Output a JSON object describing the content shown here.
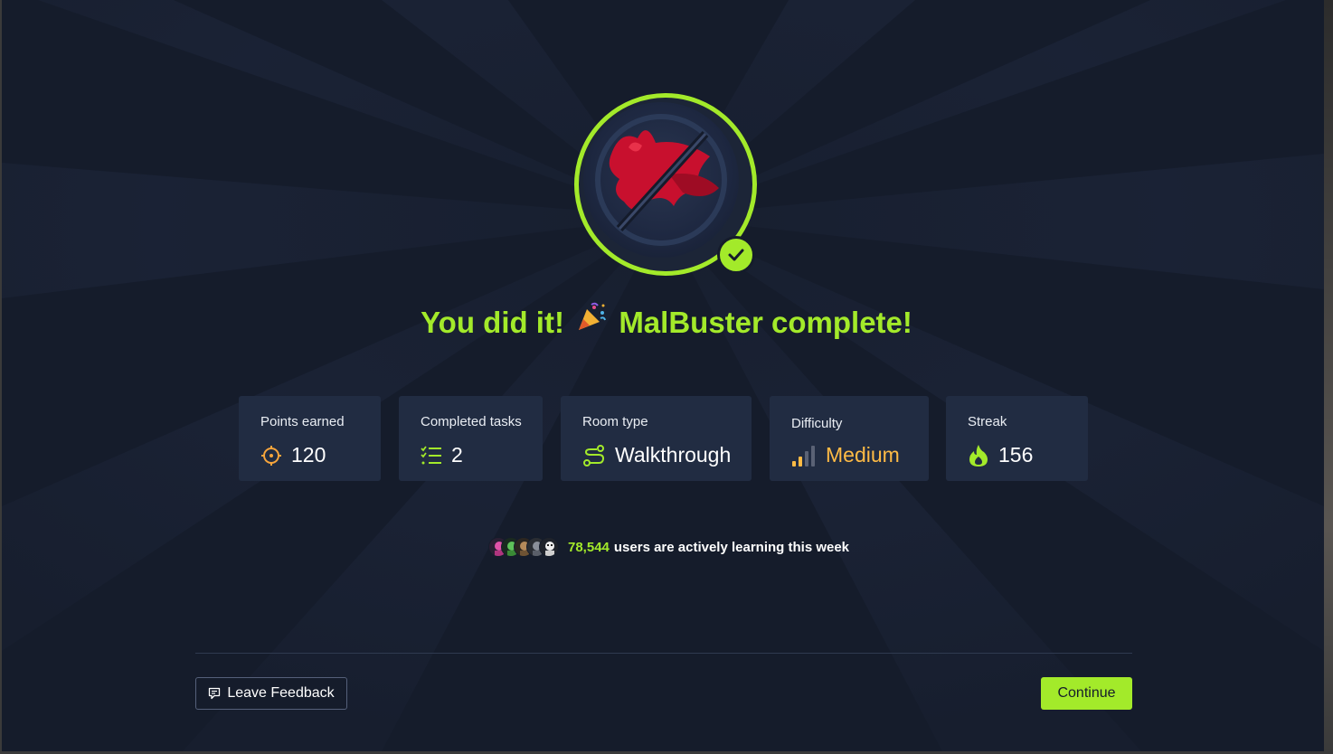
{
  "completion": {
    "title_prefix": "You did it!",
    "title_suffix": "MalBuster complete!",
    "party_icon": "party-popper-icon",
    "badge_icon": "malbuster-room-badge",
    "check_icon": "check-icon"
  },
  "stats": {
    "points": {
      "label": "Points earned",
      "value": "120",
      "icon": "target-icon"
    },
    "tasks": {
      "label": "Completed tasks",
      "value": "2",
      "icon": "checklist-icon"
    },
    "room_type": {
      "label": "Room type",
      "value": "Walkthrough",
      "icon": "route-icon"
    },
    "difficulty": {
      "label": "Difficulty",
      "value": "Medium",
      "icon": "signal-bars-icon"
    },
    "streak": {
      "label": "Streak",
      "value": "156",
      "icon": "flame-icon"
    }
  },
  "activity": {
    "count": "78,544",
    "text": "users are actively learning this week"
  },
  "footer": {
    "feedback_label": "Leave Feedback",
    "continue_label": "Continue"
  },
  "colors": {
    "accent": "#a3ea2a",
    "background": "#151c2b",
    "card": "#212c42",
    "difficulty": "#ffbb45",
    "points_icon": "#f7a53c"
  }
}
